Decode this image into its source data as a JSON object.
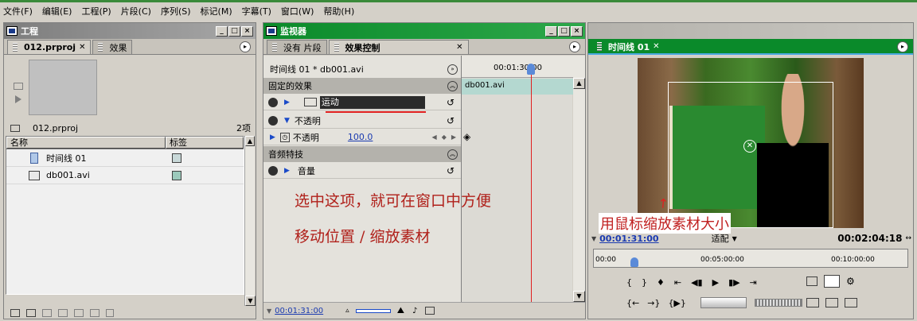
{
  "menu": [
    "文件(F)",
    "编辑(E)",
    "工程(P)",
    "片段(C)",
    "序列(S)",
    "标记(M)",
    "字幕(T)",
    "窗口(W)",
    "帮助(H)"
  ],
  "project": {
    "title": "工程",
    "tabs": [
      "012.prproj",
      "效果"
    ],
    "proj_file": "012.prproj",
    "item_count": "2项",
    "columns": [
      "名称",
      "标签"
    ],
    "items": [
      {
        "name": "时间线 01",
        "label_color": "#c8d8d8"
      },
      {
        "name": "db001.avi",
        "label_color": "#9ccabc"
      }
    ]
  },
  "monitor": {
    "title": "监视器",
    "tabs": [
      "没有 片段",
      "效果控制"
    ],
    "sequence_label": "时间线 01 * db001.avi",
    "timecode_ruler": "00:01:30:00",
    "clip_name": "db001.avi",
    "fixed_effects": "固定的效果",
    "motion": "运动",
    "opacity_group": "不透明",
    "opacity_param": "不透明",
    "opacity_value": "100.0",
    "audio_effects": "音频特技",
    "volume": "音量",
    "bottom_timecode": "00:01:31:00"
  },
  "timeline": {
    "title": "时间线 01",
    "current_time": "00:01:31:00",
    "fit_label": "适配",
    "duration": "00:02:04:18",
    "ruler_ticks": [
      "00:00",
      "00:05:00:00",
      "00:10:00:00"
    ]
  },
  "annotations": {
    "line1": "选中这项，就可在窗口中方便",
    "line2": "移动位置 / 缩放素材",
    "scale_note": "用鼠标缩放素材大小"
  },
  "colors": {
    "annotation_red": "#b0201a",
    "title_green": "#0a8a2a",
    "playhead_red": "#e02020",
    "accent_blue": "#1a6ac8"
  }
}
